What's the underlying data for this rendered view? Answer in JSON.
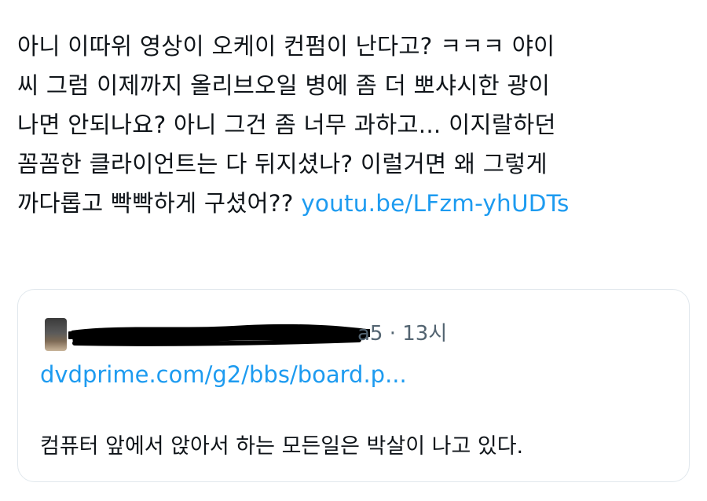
{
  "tweet": {
    "lines": [
      "아니 이따위 영상이 오케이 컨펌이 난다고? ㅋㅋㅋ 야이",
      "씨 그럼 이제까지 올리브오일 병에 좀 더 뽀샤시한 광이",
      "나면 안되나요? 아니 그건 좀 너무 과하고... 이지랄하던",
      "꼼꼼한 클라이언트는 다 뒤지셨나? 이럴거면 왜 그렇게"
    ],
    "last_line_text": "까다롭고 빡빡하게 구셨어?? ",
    "link": "youtu.be/LFzm-yhUDTs"
  },
  "quote": {
    "handle_tail": "a5 · 13시",
    "link": "dvdprime.com/g2/bbs/board.p...",
    "text": "컴퓨터 앞에서 앉아서 하는 모든일은 박살이 나고 있다."
  },
  "colors": {
    "link": "#1d9bf0",
    "text": "#0f1419",
    "muted": "#536471",
    "border": "#e1e8ed",
    "redaction": "#000000"
  }
}
